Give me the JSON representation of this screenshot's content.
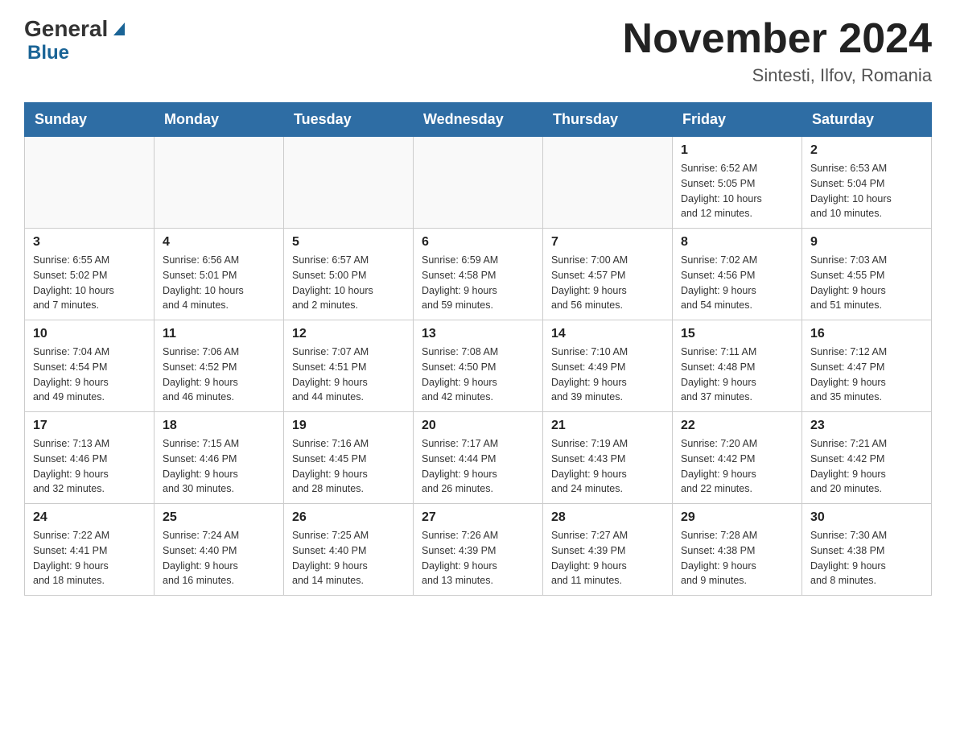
{
  "header": {
    "logo_general": "General",
    "logo_blue": "Blue",
    "month_title": "November 2024",
    "location": "Sintesti, Ilfov, Romania"
  },
  "weekdays": [
    "Sunday",
    "Monday",
    "Tuesday",
    "Wednesday",
    "Thursday",
    "Friday",
    "Saturday"
  ],
  "weeks": [
    [
      {
        "day": "",
        "info": ""
      },
      {
        "day": "",
        "info": ""
      },
      {
        "day": "",
        "info": ""
      },
      {
        "day": "",
        "info": ""
      },
      {
        "day": "",
        "info": ""
      },
      {
        "day": "1",
        "info": "Sunrise: 6:52 AM\nSunset: 5:05 PM\nDaylight: 10 hours\nand 12 minutes."
      },
      {
        "day": "2",
        "info": "Sunrise: 6:53 AM\nSunset: 5:04 PM\nDaylight: 10 hours\nand 10 minutes."
      }
    ],
    [
      {
        "day": "3",
        "info": "Sunrise: 6:55 AM\nSunset: 5:02 PM\nDaylight: 10 hours\nand 7 minutes."
      },
      {
        "day": "4",
        "info": "Sunrise: 6:56 AM\nSunset: 5:01 PM\nDaylight: 10 hours\nand 4 minutes."
      },
      {
        "day": "5",
        "info": "Sunrise: 6:57 AM\nSunset: 5:00 PM\nDaylight: 10 hours\nand 2 minutes."
      },
      {
        "day": "6",
        "info": "Sunrise: 6:59 AM\nSunset: 4:58 PM\nDaylight: 9 hours\nand 59 minutes."
      },
      {
        "day": "7",
        "info": "Sunrise: 7:00 AM\nSunset: 4:57 PM\nDaylight: 9 hours\nand 56 minutes."
      },
      {
        "day": "8",
        "info": "Sunrise: 7:02 AM\nSunset: 4:56 PM\nDaylight: 9 hours\nand 54 minutes."
      },
      {
        "day": "9",
        "info": "Sunrise: 7:03 AM\nSunset: 4:55 PM\nDaylight: 9 hours\nand 51 minutes."
      }
    ],
    [
      {
        "day": "10",
        "info": "Sunrise: 7:04 AM\nSunset: 4:54 PM\nDaylight: 9 hours\nand 49 minutes."
      },
      {
        "day": "11",
        "info": "Sunrise: 7:06 AM\nSunset: 4:52 PM\nDaylight: 9 hours\nand 46 minutes."
      },
      {
        "day": "12",
        "info": "Sunrise: 7:07 AM\nSunset: 4:51 PM\nDaylight: 9 hours\nand 44 minutes."
      },
      {
        "day": "13",
        "info": "Sunrise: 7:08 AM\nSunset: 4:50 PM\nDaylight: 9 hours\nand 42 minutes."
      },
      {
        "day": "14",
        "info": "Sunrise: 7:10 AM\nSunset: 4:49 PM\nDaylight: 9 hours\nand 39 minutes."
      },
      {
        "day": "15",
        "info": "Sunrise: 7:11 AM\nSunset: 4:48 PM\nDaylight: 9 hours\nand 37 minutes."
      },
      {
        "day": "16",
        "info": "Sunrise: 7:12 AM\nSunset: 4:47 PM\nDaylight: 9 hours\nand 35 minutes."
      }
    ],
    [
      {
        "day": "17",
        "info": "Sunrise: 7:13 AM\nSunset: 4:46 PM\nDaylight: 9 hours\nand 32 minutes."
      },
      {
        "day": "18",
        "info": "Sunrise: 7:15 AM\nSunset: 4:46 PM\nDaylight: 9 hours\nand 30 minutes."
      },
      {
        "day": "19",
        "info": "Sunrise: 7:16 AM\nSunset: 4:45 PM\nDaylight: 9 hours\nand 28 minutes."
      },
      {
        "day": "20",
        "info": "Sunrise: 7:17 AM\nSunset: 4:44 PM\nDaylight: 9 hours\nand 26 minutes."
      },
      {
        "day": "21",
        "info": "Sunrise: 7:19 AM\nSunset: 4:43 PM\nDaylight: 9 hours\nand 24 minutes."
      },
      {
        "day": "22",
        "info": "Sunrise: 7:20 AM\nSunset: 4:42 PM\nDaylight: 9 hours\nand 22 minutes."
      },
      {
        "day": "23",
        "info": "Sunrise: 7:21 AM\nSunset: 4:42 PM\nDaylight: 9 hours\nand 20 minutes."
      }
    ],
    [
      {
        "day": "24",
        "info": "Sunrise: 7:22 AM\nSunset: 4:41 PM\nDaylight: 9 hours\nand 18 minutes."
      },
      {
        "day": "25",
        "info": "Sunrise: 7:24 AM\nSunset: 4:40 PM\nDaylight: 9 hours\nand 16 minutes."
      },
      {
        "day": "26",
        "info": "Sunrise: 7:25 AM\nSunset: 4:40 PM\nDaylight: 9 hours\nand 14 minutes."
      },
      {
        "day": "27",
        "info": "Sunrise: 7:26 AM\nSunset: 4:39 PM\nDaylight: 9 hours\nand 13 minutes."
      },
      {
        "day": "28",
        "info": "Sunrise: 7:27 AM\nSunset: 4:39 PM\nDaylight: 9 hours\nand 11 minutes."
      },
      {
        "day": "29",
        "info": "Sunrise: 7:28 AM\nSunset: 4:38 PM\nDaylight: 9 hours\nand 9 minutes."
      },
      {
        "day": "30",
        "info": "Sunrise: 7:30 AM\nSunset: 4:38 PM\nDaylight: 9 hours\nand 8 minutes."
      }
    ]
  ]
}
